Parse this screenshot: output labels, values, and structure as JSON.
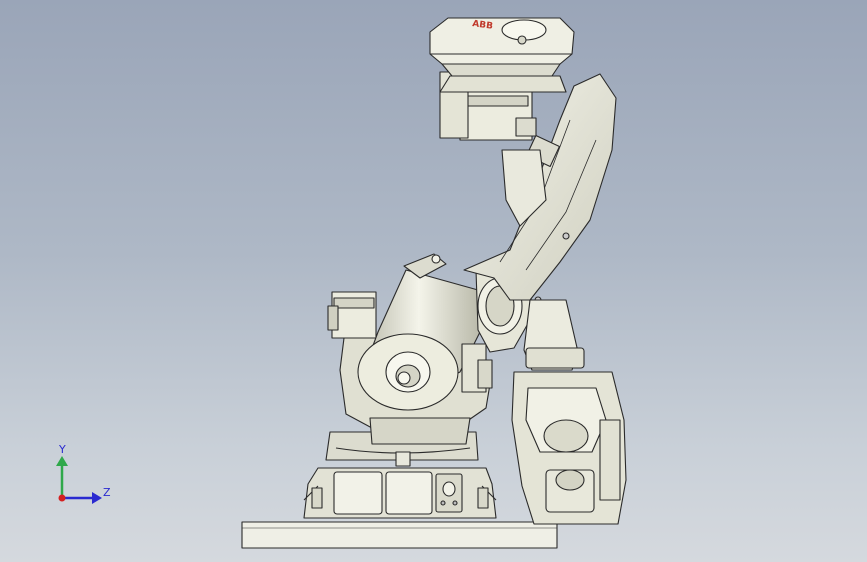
{
  "scene": {
    "description_free": true,
    "background_gradient": [
      "#9aa5b8",
      "#aeb8c6",
      "#c9d0d8",
      "#d5d9de"
    ],
    "model_fill": "#e8e8dc",
    "model_shade": "#c9c9bb",
    "model_edge": "#2b2b2b",
    "logo_text": "ABB",
    "logo_color": "#c0392b"
  },
  "triad": {
    "y_label": "Y",
    "z_label": "Z",
    "y_color": "#2fa84a",
    "z_color": "#2a2ad0",
    "origin_color": "#d42020"
  }
}
